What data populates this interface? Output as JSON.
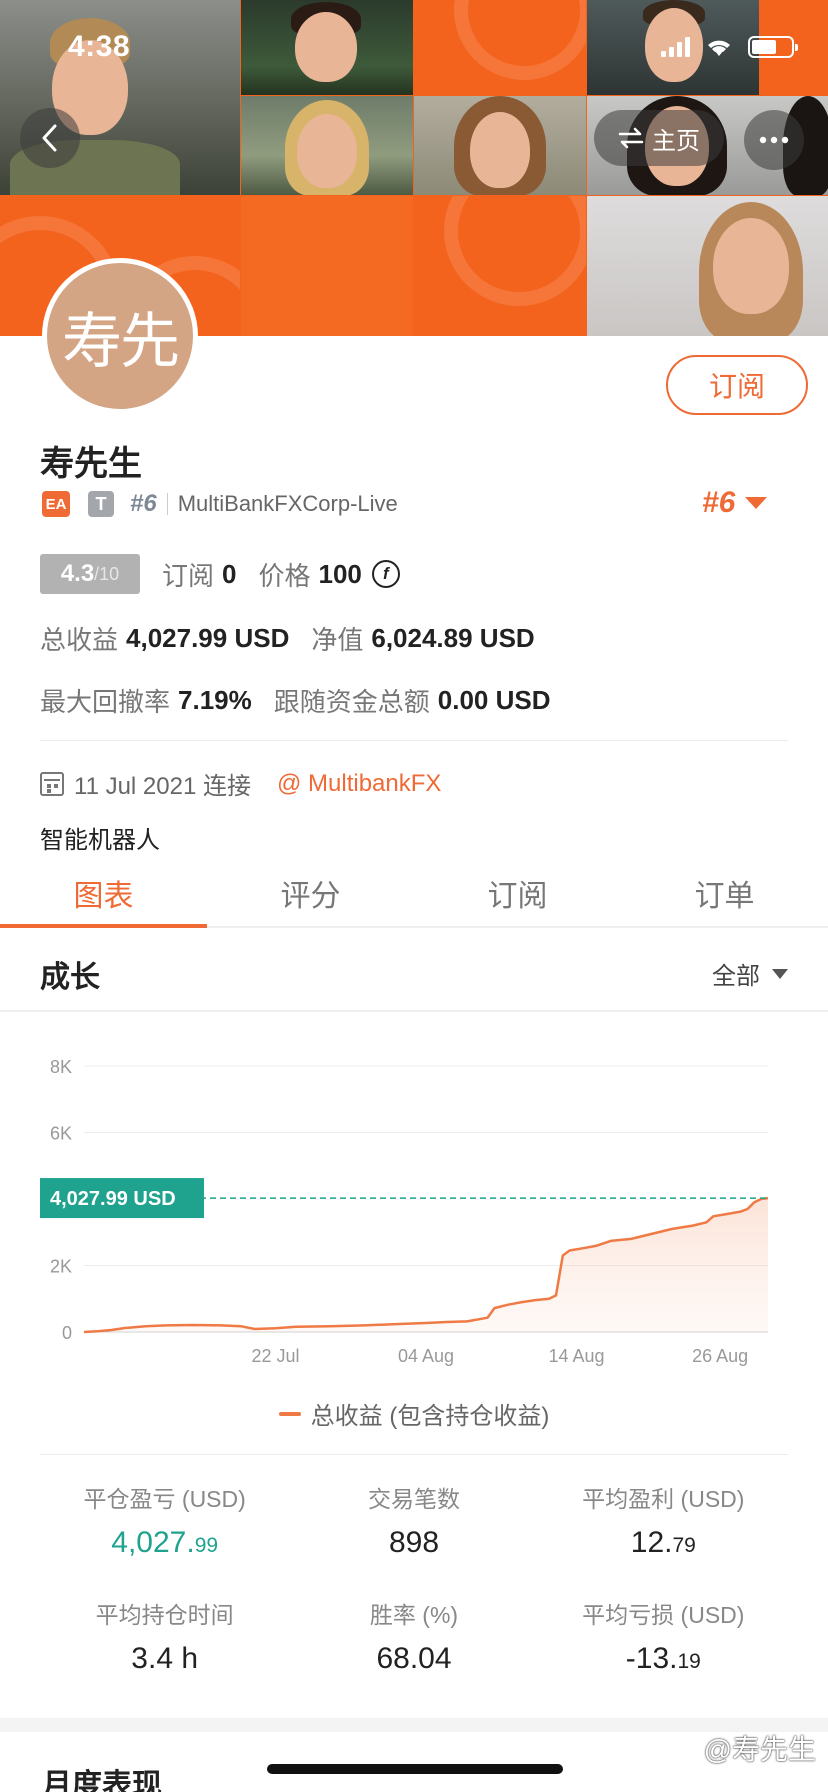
{
  "status_bar": {
    "time": "4:38"
  },
  "nav": {
    "back_icon": "chevron-left-icon",
    "home_label": "主页",
    "more_icon": "more-dots-icon"
  },
  "profile": {
    "avatar_text": "寿先",
    "name": "寿先生",
    "subscribe_label": "订阅",
    "badge_ea": "EA",
    "badge_t": "T",
    "rank_small": "#6",
    "server": "MultiBankFXCorp-Live",
    "rank_big": "#6"
  },
  "stats": {
    "rating_main": "4.3",
    "rating_sub": "/10",
    "subs_label": "订阅",
    "subs_value": "0",
    "price_label": "价格",
    "price_value": "100",
    "coin_symbol": "f",
    "profit_label": "总收益",
    "profit_value": "4,027.99 USD",
    "equity_label": "净值",
    "equity_value": "6,024.89 USD",
    "drawdown_label": "最大回撤率",
    "drawdown_value": "7.19%",
    "follow_label": "跟随资金总额",
    "follow_value": "0.00 USD"
  },
  "meta": {
    "connected": "11 Jul 2021 连接",
    "broker": "@ MultibankFX",
    "robot_label": "智能机器人"
  },
  "tabs": [
    {
      "label": "图表",
      "active": true
    },
    {
      "label": "评分",
      "active": false
    },
    {
      "label": "订阅",
      "active": false
    },
    {
      "label": "订单",
      "active": false
    }
  ],
  "section": {
    "title": "成长",
    "filter": "全部"
  },
  "chart_data": {
    "type": "area",
    "y_ticks": [
      "8K",
      "6K",
      "2K",
      "0"
    ],
    "x_ticks": [
      "22 Jul",
      "04 Aug",
      "14 Aug",
      "26 Aug"
    ],
    "ylim": [
      0,
      8000
    ],
    "current_label": "4,027.99 USD",
    "current_value": 4027.99,
    "legend": "总收益 (包含持仓收益)",
    "line_color": "#ef7a45",
    "label_color": "#1fa38e",
    "series": [
      {
        "name": "总收益 (包含持仓收益)",
        "points": [
          [
            0,
            0
          ],
          [
            0.02,
            20
          ],
          [
            0.04,
            60
          ],
          [
            0.06,
            120
          ],
          [
            0.09,
            170
          ],
          [
            0.12,
            200
          ],
          [
            0.16,
            210
          ],
          [
            0.2,
            200
          ],
          [
            0.23,
            170
          ],
          [
            0.25,
            90
          ],
          [
            0.28,
            110
          ],
          [
            0.31,
            160
          ],
          [
            0.36,
            170
          ],
          [
            0.41,
            200
          ],
          [
            0.46,
            240
          ],
          [
            0.5,
            270
          ],
          [
            0.53,
            300
          ],
          [
            0.56,
            320
          ],
          [
            0.59,
            430
          ],
          [
            0.6,
            720
          ],
          [
            0.62,
            820
          ],
          [
            0.64,
            900
          ],
          [
            0.66,
            960
          ],
          [
            0.68,
            1000
          ],
          [
            0.69,
            1100
          ],
          [
            0.7,
            2300
          ],
          [
            0.71,
            2450
          ],
          [
            0.73,
            2520
          ],
          [
            0.75,
            2600
          ],
          [
            0.77,
            2740
          ],
          [
            0.8,
            2800
          ],
          [
            0.83,
            2950
          ],
          [
            0.86,
            3100
          ],
          [
            0.89,
            3200
          ],
          [
            0.91,
            3300
          ],
          [
            0.92,
            3480
          ],
          [
            0.94,
            3550
          ],
          [
            0.96,
            3620
          ],
          [
            0.97,
            3700
          ],
          [
            0.98,
            3900
          ],
          [
            0.99,
            4000
          ],
          [
            1.0,
            4027.99
          ]
        ]
      }
    ]
  },
  "summary": [
    {
      "label": "平仓盈亏 (USD)",
      "main": "4,027.",
      "small": "99",
      "green": true
    },
    {
      "label": "交易笔数",
      "main": "898",
      "small": "",
      "green": false
    },
    {
      "label": "平均盈利 (USD)",
      "main": "12.",
      "small": "79",
      "green": false
    },
    {
      "label": "平均持仓时间",
      "main": "3.4 h",
      "small": "",
      "green": false
    },
    {
      "label": "胜率 (%)",
      "main": "68.04",
      "small": "",
      "green": false
    },
    {
      "label": "平均亏损 (USD)",
      "main": "-13.",
      "small": "19",
      "green": false
    }
  ],
  "monthly": {
    "title": "月度表现"
  },
  "watermark": "@寿先生"
}
